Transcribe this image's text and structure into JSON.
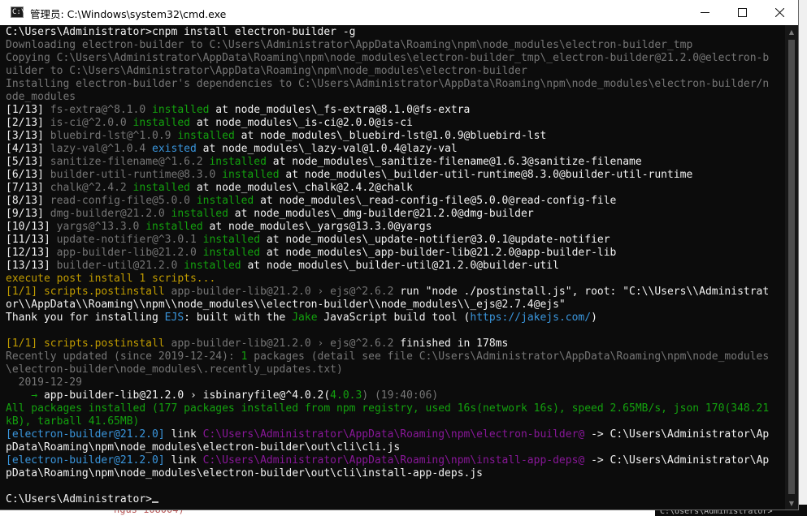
{
  "window": {
    "title": "管理员: C:\\Windows\\system32\\cmd.exe",
    "icon_text": "C:\\"
  },
  "background": {
    "fragment_left": "ngus-108004)",
    "fragment_right": "C:\\Users\\Administrator>"
  },
  "colors": {
    "console_bg": "#0c0c0c",
    "default_text": "#c0c0c0",
    "gray": "#767676",
    "green": "#13a10e",
    "cyan": "#3a96dd",
    "yellow": "#c19c00",
    "magenta": "#881798",
    "white": "#f2f2f2"
  },
  "console": {
    "lines": [
      [
        {
          "t": "C:\\Users\\Administrator>cnpm install electron-builder -g",
          "c": "white"
        }
      ],
      [
        {
          "t": "Downloading electron-builder to C:\\Users\\Administrator\\AppData\\Roaming\\npm\\node_modules\\electron-builder_tmp",
          "c": "gray"
        }
      ],
      [
        {
          "t": "Copying C:\\Users\\Administrator\\AppData\\Roaming\\npm\\node_modules\\electron-builder_tmp\\_electron-builder@21.2.0@electron-b",
          "c": "gray"
        }
      ],
      [
        {
          "t": "uilder to C:\\Users\\Administrator\\AppData\\Roaming\\npm\\node_modules\\electron-builder",
          "c": "gray"
        }
      ],
      [
        {
          "t": "Installing electron-builder's dependencies to C:\\Users\\Administrator\\AppData\\Roaming\\npm\\node_modules\\electron-builder/n",
          "c": "gray"
        }
      ],
      [
        {
          "t": "ode_modules",
          "c": "gray"
        }
      ],
      [
        {
          "t": "[1/13] ",
          "c": "white"
        },
        {
          "t": "fs-extra@^8.1.0 ",
          "c": "gray"
        },
        {
          "t": "installed",
          "c": "green"
        },
        {
          "t": " at node_modules\\_fs-extra@8.1.0@fs-extra",
          "c": "white"
        }
      ],
      [
        {
          "t": "[2/13] ",
          "c": "white"
        },
        {
          "t": "is-ci@^2.0.0 ",
          "c": "gray"
        },
        {
          "t": "installed",
          "c": "green"
        },
        {
          "t": " at node_modules\\_is-ci@2.0.0@is-ci",
          "c": "white"
        }
      ],
      [
        {
          "t": "[3/13] ",
          "c": "white"
        },
        {
          "t": "bluebird-lst@^1.0.9 ",
          "c": "gray"
        },
        {
          "t": "installed",
          "c": "green"
        },
        {
          "t": " at node_modules\\_bluebird-lst@1.0.9@bluebird-lst",
          "c": "white"
        }
      ],
      [
        {
          "t": "[4/13] ",
          "c": "white"
        },
        {
          "t": "lazy-val@^1.0.4 ",
          "c": "gray"
        },
        {
          "t": "existed",
          "c": "cyan"
        },
        {
          "t": " at node_modules\\_lazy-val@1.0.4@lazy-val",
          "c": "white"
        }
      ],
      [
        {
          "t": "[5/13] ",
          "c": "white"
        },
        {
          "t": "sanitize-filename@^1.6.2 ",
          "c": "gray"
        },
        {
          "t": "installed",
          "c": "green"
        },
        {
          "t": " at node_modules\\_sanitize-filename@1.6.3@sanitize-filename",
          "c": "white"
        }
      ],
      [
        {
          "t": "[6/13] ",
          "c": "white"
        },
        {
          "t": "builder-util-runtime@8.3.0 ",
          "c": "gray"
        },
        {
          "t": "installed",
          "c": "green"
        },
        {
          "t": " at node_modules\\_builder-util-runtime@8.3.0@builder-util-runtime",
          "c": "white"
        }
      ],
      [
        {
          "t": "[7/13] ",
          "c": "white"
        },
        {
          "t": "chalk@^2.4.2 ",
          "c": "gray"
        },
        {
          "t": "installed",
          "c": "green"
        },
        {
          "t": " at node_modules\\_chalk@2.4.2@chalk",
          "c": "white"
        }
      ],
      [
        {
          "t": "[8/13] ",
          "c": "white"
        },
        {
          "t": "read-config-file@5.0.0 ",
          "c": "gray"
        },
        {
          "t": "installed",
          "c": "green"
        },
        {
          "t": " at node_modules\\_read-config-file@5.0.0@read-config-file",
          "c": "white"
        }
      ],
      [
        {
          "t": "[9/13] ",
          "c": "white"
        },
        {
          "t": "dmg-builder@21.2.0 ",
          "c": "gray"
        },
        {
          "t": "installed",
          "c": "green"
        },
        {
          "t": " at node_modules\\_dmg-builder@21.2.0@dmg-builder",
          "c": "white"
        }
      ],
      [
        {
          "t": "[10/13] ",
          "c": "white"
        },
        {
          "t": "yargs@^13.3.0 ",
          "c": "gray"
        },
        {
          "t": "installed",
          "c": "green"
        },
        {
          "t": " at node_modules\\_yargs@13.3.0@yargs",
          "c": "white"
        }
      ],
      [
        {
          "t": "[11/13] ",
          "c": "white"
        },
        {
          "t": "update-notifier@^3.0.1 ",
          "c": "gray"
        },
        {
          "t": "installed",
          "c": "green"
        },
        {
          "t": " at node_modules\\_update-notifier@3.0.1@update-notifier",
          "c": "white"
        }
      ],
      [
        {
          "t": "[12/13] ",
          "c": "white"
        },
        {
          "t": "app-builder-lib@21.2.0 ",
          "c": "gray"
        },
        {
          "t": "installed",
          "c": "green"
        },
        {
          "t": " at node_modules\\_app-builder-lib@21.2.0@app-builder-lib",
          "c": "white"
        }
      ],
      [
        {
          "t": "[13/13] ",
          "c": "white"
        },
        {
          "t": "builder-util@21.2.0 ",
          "c": "gray"
        },
        {
          "t": "installed",
          "c": "green"
        },
        {
          "t": " at node_modules\\_builder-util@21.2.0@builder-util",
          "c": "white"
        }
      ],
      [
        {
          "t": "execute post install 1 scripts...",
          "c": "yellow"
        }
      ],
      [
        {
          "t": "[1/1] scripts.postinstall",
          "c": "yellow"
        },
        {
          "t": " app-builder-lib@21.2.0 › ejs@^2.6.2 ",
          "c": "gray"
        },
        {
          "t": "run \"node ./postinstall.js\", root: \"C:\\\\Users\\\\Administrat",
          "c": "white"
        }
      ],
      [
        {
          "t": "or\\\\AppData\\\\Roaming\\\\npm\\\\node_modules\\\\electron-builder\\\\node_modules\\\\_ejs@2.7.4@ejs\"",
          "c": "white"
        }
      ],
      [
        {
          "t": "Thank you for installing ",
          "c": "white"
        },
        {
          "t": "EJS",
          "c": "cyan"
        },
        {
          "t": ": built with the ",
          "c": "white"
        },
        {
          "t": "Jake",
          "c": "green"
        },
        {
          "t": " JavaScript build tool (",
          "c": "white"
        },
        {
          "t": "https://jakejs.com/",
          "c": "cyan"
        },
        {
          "t": ")",
          "c": "white"
        }
      ],
      [
        {
          "t": "",
          "c": "white"
        }
      ],
      [
        {
          "t": "[1/1] scripts.postinstall",
          "c": "yellow"
        },
        {
          "t": " app-builder-lib@21.2.0 › ejs@^2.6.2 ",
          "c": "gray"
        },
        {
          "t": "finished in 178ms",
          "c": "white"
        }
      ],
      [
        {
          "t": "Recently updated (since 2019-12-24): ",
          "c": "gray"
        },
        {
          "t": "1",
          "c": "green"
        },
        {
          "t": " packages (detail see file C:\\Users\\Administrator\\AppData\\Roaming\\npm\\node_modules",
          "c": "gray"
        }
      ],
      [
        {
          "t": "\\electron-builder\\node_modules\\.recently_updates.txt)",
          "c": "gray"
        }
      ],
      [
        {
          "t": "  2019-12-29",
          "c": "gray"
        }
      ],
      [
        {
          "t": "    → ",
          "c": "green"
        },
        {
          "t": "app-builder-lib@21.2.0 › isbinaryfile@^4.0.2(",
          "c": "white"
        },
        {
          "t": "4.0.3",
          "c": "green"
        },
        {
          "t": ") (19:40:06)",
          "c": "gray"
        }
      ],
      [
        {
          "t": "All packages installed (177 packages installed from npm registry, used 16s(network 16s), speed 2.65MB/s, json 170(348.21",
          "c": "green"
        }
      ],
      [
        {
          "t": "kB), tarball 41.65MB)",
          "c": "green"
        }
      ],
      [
        {
          "t": "[electron-builder@21.2.0]",
          "c": "cyan"
        },
        {
          "t": " link ",
          "c": "white"
        },
        {
          "t": "C:\\Users\\Administrator\\AppData\\Roaming\\npm\\electron-builder@",
          "c": "magenta"
        },
        {
          "t": " -> C:\\Users\\Administrator\\Ap",
          "c": "white"
        }
      ],
      [
        {
          "t": "pData\\Roaming\\npm\\node_modules\\electron-builder\\out\\cli\\cli.js",
          "c": "white"
        }
      ],
      [
        {
          "t": "[electron-builder@21.2.0]",
          "c": "cyan"
        },
        {
          "t": " link ",
          "c": "white"
        },
        {
          "t": "C:\\Users\\Administrator\\AppData\\Roaming\\npm\\install-app-deps@",
          "c": "magenta"
        },
        {
          "t": " -> C:\\Users\\Administrator\\Ap",
          "c": "white"
        }
      ],
      [
        {
          "t": "pData\\Roaming\\npm\\node_modules\\electron-builder\\out\\cli\\install-app-deps.js",
          "c": "white"
        }
      ],
      [
        {
          "t": "",
          "c": "white"
        }
      ],
      [
        {
          "t": "C:\\Users\\Administrator>",
          "c": "white"
        }
      ]
    ]
  }
}
